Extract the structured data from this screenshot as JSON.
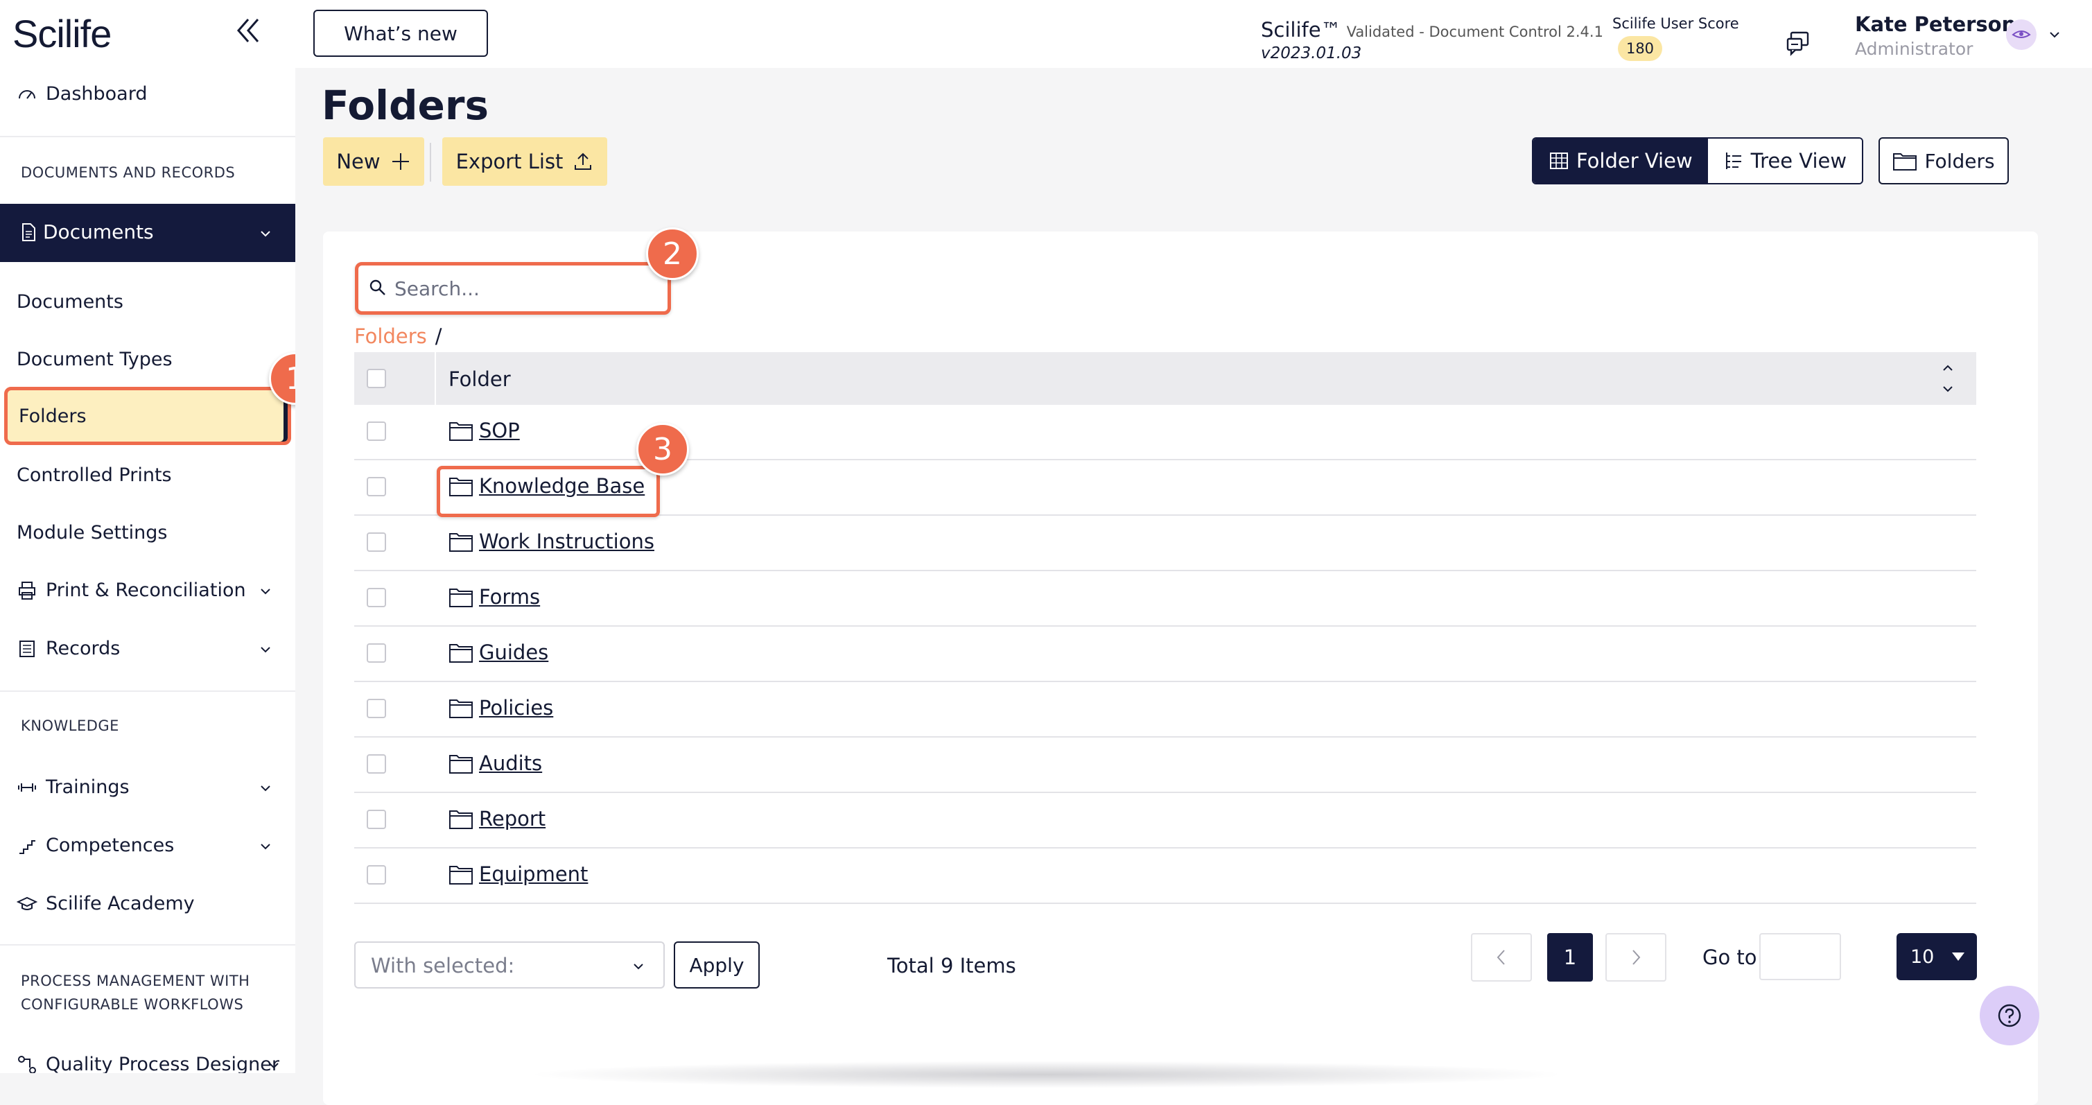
{
  "sidebar": {
    "logo": "Scilife",
    "dashboard": "Dashboard",
    "section_documents": "DOCUMENTS AND RECORDS",
    "documents_group": "Documents",
    "sub_items": [
      "Documents",
      "Document Types",
      "Folders",
      "Controlled Prints",
      "Module Settings"
    ],
    "print_reconciliation": "Print & Reconciliation",
    "records": "Records",
    "section_knowledge": "KNOWLEDGE",
    "trainings": "Trainings",
    "competences": "Competences",
    "academy": "Scilife Academy",
    "section_process_1": "PROCESS MANAGEMENT WITH",
    "section_process_2": "CONFIGURABLE WORKFLOWS",
    "quality_designer": "Quality Process Designer"
  },
  "header": {
    "whats_new": "What’s new",
    "product": "Scilife™",
    "product_sub": "Validated - Document Control 2.4.1",
    "version": "v2023.01.03",
    "score_label": "Scilife User Score",
    "score_value": "180",
    "user_name": "Kate Peterson",
    "user_role": "Administrator"
  },
  "main": {
    "title": "Folders",
    "new_label": "New",
    "export_label": "Export List",
    "folder_view": "Folder View",
    "tree_view": "Tree View",
    "folders_button": "Folders",
    "search_placeholder": "Search...",
    "breadcrumb_root": "Folders",
    "breadcrumb_sep": "/",
    "column_folder": "Folder",
    "rows": [
      "SOP",
      "Knowledge Base",
      "Work Instructions",
      "Forms",
      "Guides",
      "Policies",
      "Audits",
      "Report",
      "Equipment"
    ],
    "with_selected": "With selected:",
    "apply": "Apply",
    "total": "Total 9 Items",
    "current_page": "1",
    "goto_label": "Go to",
    "page_size": "10"
  },
  "annotations": {
    "step1": "1",
    "step2": "2",
    "step3": "3"
  },
  "colors": {
    "accent": "#ef6b4c",
    "navy": "#141a3d",
    "yellow": "#fbe6a3",
    "active_bg": "#fdefc0"
  }
}
